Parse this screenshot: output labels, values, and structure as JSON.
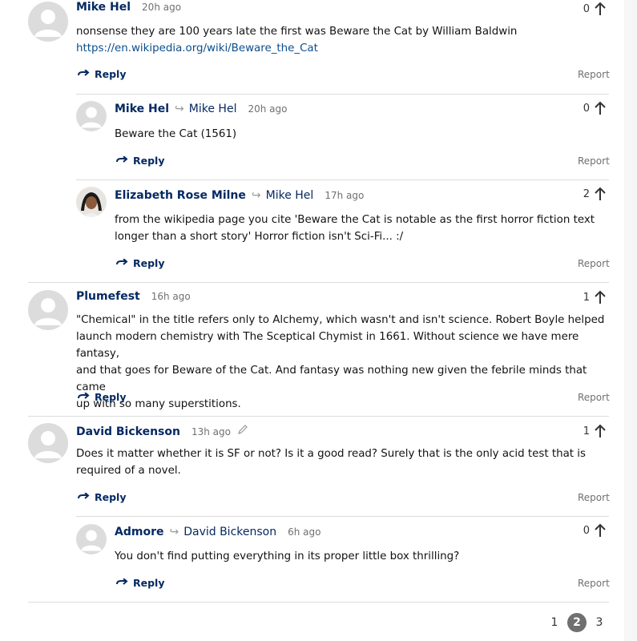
{
  "comments": [
    {
      "author": "Mike Hel",
      "reply_to": "",
      "time": "20h ago",
      "votes": "0",
      "body": "nonsense they are 100 years late the first was Beware the Cat by William Baldwin",
      "link": "https://en.wikipedia.org/wiki/Beware_the_Cat"
    },
    {
      "author": "Mike Hel",
      "reply_to": "Mike Hel",
      "time": "20h ago",
      "votes": "0",
      "body": "Beware the Cat (1561)"
    },
    {
      "author": "Elizabeth Rose Milne",
      "reply_to": "Mike Hel",
      "time": "17h ago",
      "votes": "2",
      "body_l1": "from the wikipedia page you cite 'Beware the Cat is notable as the first horror fiction text",
      "body_l2": "longer than a short story' Horror fiction isn't Sci-Fi... :/"
    },
    {
      "author": "Plumefest",
      "reply_to": "",
      "time": "16h ago",
      "votes": "1",
      "body_l1": "\"Chemical\" in the title refers only to Alchemy, which wasn't and isn't science. Robert Boyle helped",
      "body_l2": "launch modern chemistry with The Sceptical Chymist in 1661. Without science we have mere fantasy,",
      "body_l3": "and that goes for Beware of the Cat. And fantasy was nothing new given the febrile minds that came",
      "body_l4": "up with so many superstitions."
    },
    {
      "author": "David Bickenson",
      "reply_to": "",
      "time": "13h ago",
      "votes": "1",
      "body_l1": "Does it matter whether it is SF or not? Is it a good read? Surely that is the only acid test that is",
      "body_l2": "required of a novel."
    },
    {
      "author": "Admore",
      "reply_to": "David Bickenson",
      "time": "6h ago",
      "votes": "0",
      "body": "You don't find putting everything in its proper little box thrilling?"
    }
  ],
  "labels": {
    "reply": "Reply",
    "report": "Report"
  },
  "pagination": {
    "pages": [
      "1",
      "2",
      "3"
    ],
    "current": "2"
  },
  "colors": {
    "author": "#052962",
    "link": "#0b4e8c",
    "muted": "#707070"
  },
  "icons": {
    "reply": "reply-arrow-icon",
    "upvote": "arrow-up-icon",
    "edited": "pencil-icon",
    "avatar": "default-avatar-icon"
  }
}
